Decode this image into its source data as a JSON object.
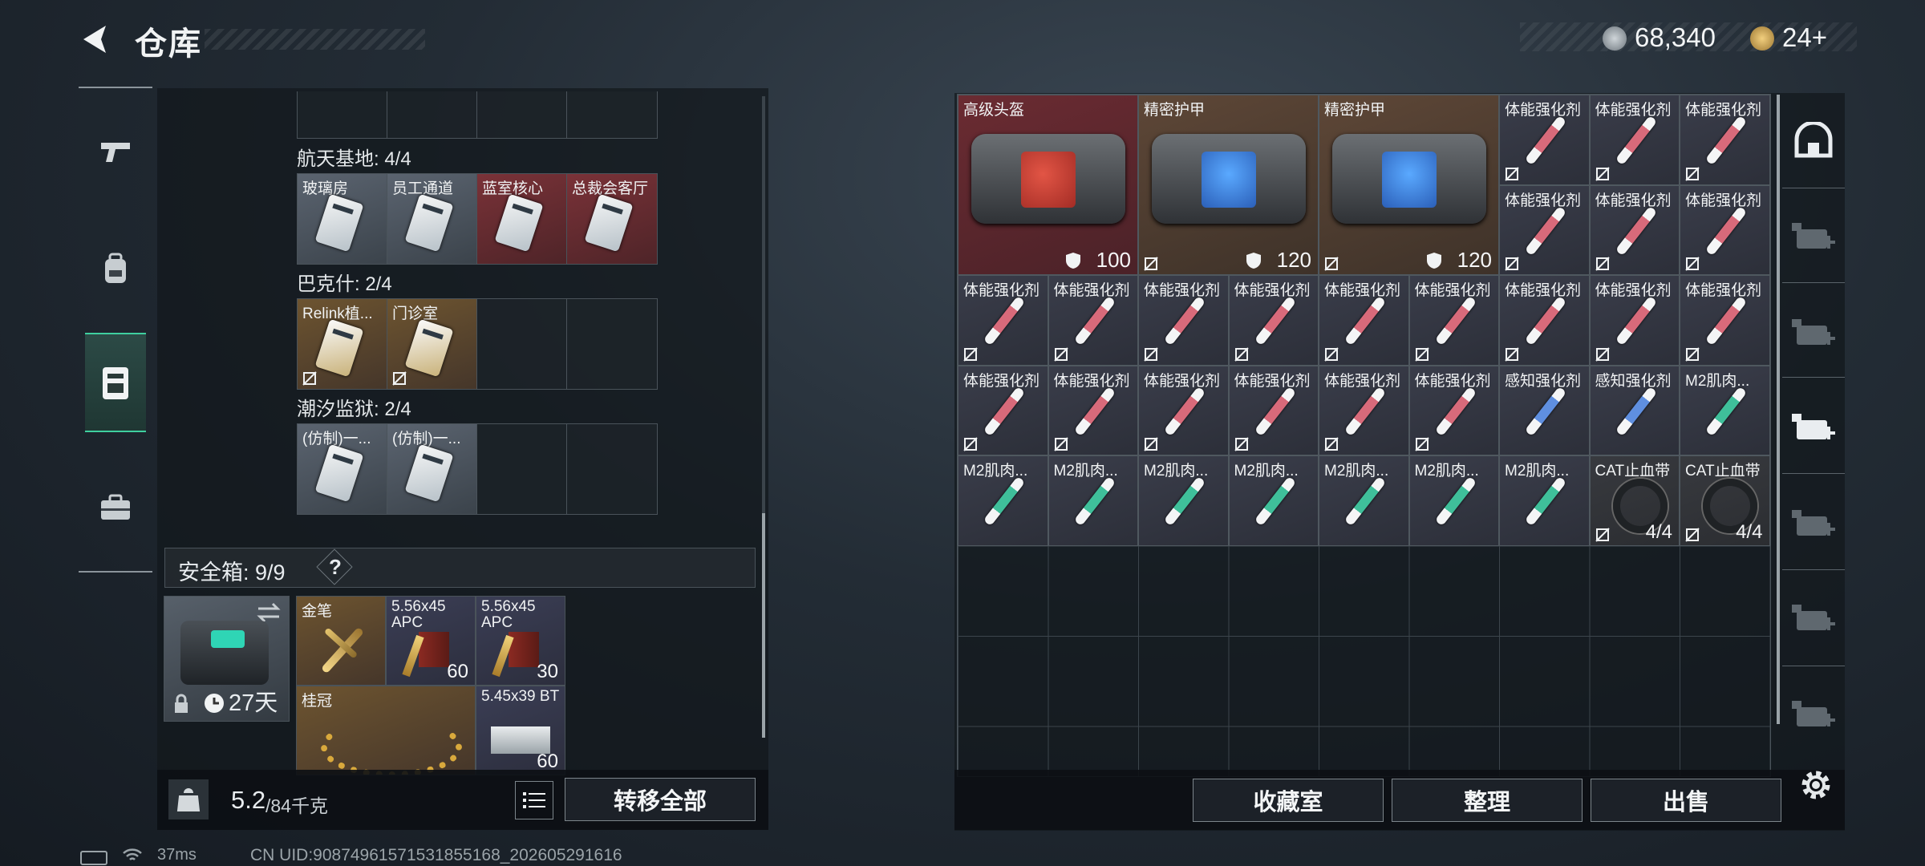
{
  "header": {
    "title": "仓库"
  },
  "currency": [
    {
      "icon": "silver-coin-icon",
      "value": "68,340"
    },
    {
      "icon": "gold-coin-icon",
      "value": "24+"
    }
  ],
  "nav": [
    "pistol-icon",
    "backpack-icon",
    "case-icon",
    "toolbox-icon"
  ],
  "groups": [
    {
      "label": "航天基地: 4/4",
      "items": [
        {
          "name": "玻璃房",
          "color": "gray",
          "locked": false
        },
        {
          "name": "员工通道",
          "color": "gray",
          "locked": false
        },
        {
          "name": "蓝室核心",
          "color": "red",
          "locked": false
        },
        {
          "name": "总裁会客厅",
          "color": "red",
          "locked": false
        }
      ]
    },
    {
      "label": "巴克什: 2/4",
      "items": [
        {
          "name": "Relink植...",
          "color": "gold",
          "locked": true
        },
        {
          "name": "门诊室",
          "color": "gold",
          "locked": true
        },
        {
          "name": "",
          "color": "empty",
          "locked": false
        },
        {
          "name": "",
          "color": "empty",
          "locked": false
        }
      ]
    },
    {
      "label": "潮汐监狱: 2/4",
      "items": [
        {
          "name": "(仿制)一...",
          "color": "gray",
          "locked": false
        },
        {
          "name": "(仿制)一...",
          "color": "gray",
          "locked": false
        },
        {
          "name": "",
          "color": "empty",
          "locked": false
        },
        {
          "name": "",
          "color": "empty",
          "locked": false
        }
      ]
    }
  ],
  "safe": {
    "label": "安全箱: 9/9",
    "help": "?",
    "timer": "27天",
    "items": [
      {
        "name": "金笔",
        "count": ""
      },
      {
        "name": "5.56x45 APC",
        "count": "60"
      },
      {
        "name": "5.56x45 APC",
        "count": "30"
      },
      {
        "name": "桂冠",
        "count": ""
      },
      {
        "name": "5.45x39 BT",
        "count": "60"
      }
    ]
  },
  "weight": {
    "current": "5.2",
    "max": "/84千克"
  },
  "buttons": {
    "transfer_all": "转移全部",
    "collection": "收藏室",
    "organize": "整理",
    "sell": "出售"
  },
  "grid_items": [
    {
      "name": "高级头盔",
      "bg": "red",
      "type": "bag-red",
      "count": "100",
      "w": 2,
      "h": 2
    },
    {
      "name": "精密护甲",
      "bg": "brown",
      "type": "bag-blue",
      "count": "120",
      "w": 2,
      "h": 2,
      "locked": true
    },
    {
      "name": "精密护甲",
      "bg": "brown",
      "type": "bag-blue",
      "count": "120",
      "w": 2,
      "h": 2,
      "locked": true
    },
    {
      "name": "体能强化剂",
      "bg": "std",
      "type": "red"
    },
    {
      "name": "体能强化剂",
      "bg": "std",
      "type": "red"
    },
    {
      "name": "体能强化剂",
      "bg": "std",
      "type": "red"
    },
    {
      "name": "体能强化剂",
      "bg": "std",
      "type": "red"
    },
    {
      "name": "体能强化剂",
      "bg": "std",
      "type": "red"
    },
    {
      "name": "体能强化剂",
      "bg": "std",
      "type": "red"
    },
    {
      "name": "体能强化剂",
      "bg": "std",
      "type": "red"
    },
    {
      "name": "体能强化剂",
      "bg": "std",
      "type": "red"
    },
    {
      "name": "体能强化剂",
      "bg": "std",
      "type": "red"
    },
    {
      "name": "体能强化剂",
      "bg": "std",
      "type": "red"
    },
    {
      "name": "体能强化剂",
      "bg": "std",
      "type": "red"
    },
    {
      "name": "体能强化剂",
      "bg": "std",
      "type": "red"
    },
    {
      "name": "体能强化剂",
      "bg": "std",
      "type": "red"
    },
    {
      "name": "体能强化剂",
      "bg": "std",
      "type": "red"
    },
    {
      "name": "体能强化剂",
      "bg": "std",
      "type": "red"
    },
    {
      "name": "体能强化剂",
      "bg": "std",
      "type": "red"
    },
    {
      "name": "体能强化剂",
      "bg": "std",
      "type": "red"
    },
    {
      "name": "体能强化剂",
      "bg": "std",
      "type": "red"
    },
    {
      "name": "体能强化剂",
      "bg": "std",
      "type": "red"
    },
    {
      "name": "体能强化剂",
      "bg": "std",
      "type": "red"
    },
    {
      "name": "体能强化剂",
      "bg": "std",
      "type": "red"
    },
    {
      "name": "感知强化剂",
      "bg": "std",
      "type": "blue"
    },
    {
      "name": "感知强化剂",
      "bg": "std",
      "type": "blue"
    },
    {
      "name": "M2肌肉...",
      "bg": "std",
      "type": "green"
    },
    {
      "name": "M2肌肉...",
      "bg": "std",
      "type": "green"
    },
    {
      "name": "M2肌肉...",
      "bg": "std",
      "type": "green"
    },
    {
      "name": "M2肌肉...",
      "bg": "std",
      "type": "green"
    },
    {
      "name": "M2肌肉...",
      "bg": "std",
      "type": "green"
    },
    {
      "name": "M2肌肉...",
      "bg": "std",
      "type": "green"
    },
    {
      "name": "M2肌肉...",
      "bg": "std",
      "type": "green"
    },
    {
      "name": "M2肌肉...",
      "bg": "std",
      "type": "green"
    },
    {
      "name": "CAT止血带",
      "bg": "dark",
      "type": "tourniquet",
      "count": "4/4"
    },
    {
      "name": "CAT止血带",
      "bg": "dark",
      "type": "tourniquet",
      "count": "4/4"
    }
  ],
  "side_icons": [
    "shelter-icon",
    "tier-3-rack-icon",
    "tier-4-medic-add-icon",
    "tier-4-medic-add-icon",
    "tier-3-wrench-icon",
    "tier-4-wrench-icon",
    "tier-4-wrench-icon"
  ],
  "status": {
    "ping": "37ms",
    "uid": "CN UID:90874961571531855168_202605291616"
  },
  "colors": {
    "accent": "#3fcf9f",
    "red_injector": "#d86a7a",
    "blue_injector": "#5f8fe0",
    "green_injector": "#3fbf9a"
  }
}
